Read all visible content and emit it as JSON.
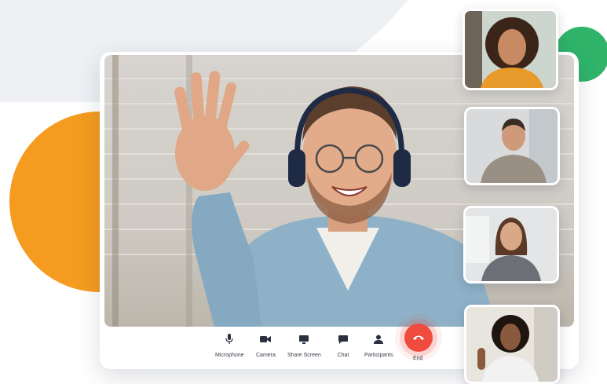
{
  "colors": {
    "accent_orange": "#f59c20",
    "accent_green": "#2fb46a",
    "end_red": "#ef4b3f",
    "icon_dark": "#2b3040"
  },
  "controls": [
    {
      "label": "Microphone",
      "icon": "microphone-icon"
    },
    {
      "label": "Camera",
      "icon": "camera-icon"
    },
    {
      "label": "Share Screen",
      "icon": "share-screen-icon"
    },
    {
      "label": "Chat",
      "icon": "chat-icon"
    },
    {
      "label": "Participants",
      "icon": "participants-icon"
    }
  ],
  "end_call": {
    "label": "End",
    "icon": "phone-hangup-icon"
  },
  "participants": [
    {
      "icon": "participant-woman-curly-hair"
    },
    {
      "icon": "participant-man-beard"
    },
    {
      "icon": "participant-woman-long-hair"
    },
    {
      "icon": "participant-woman-curly-dark"
    }
  ]
}
